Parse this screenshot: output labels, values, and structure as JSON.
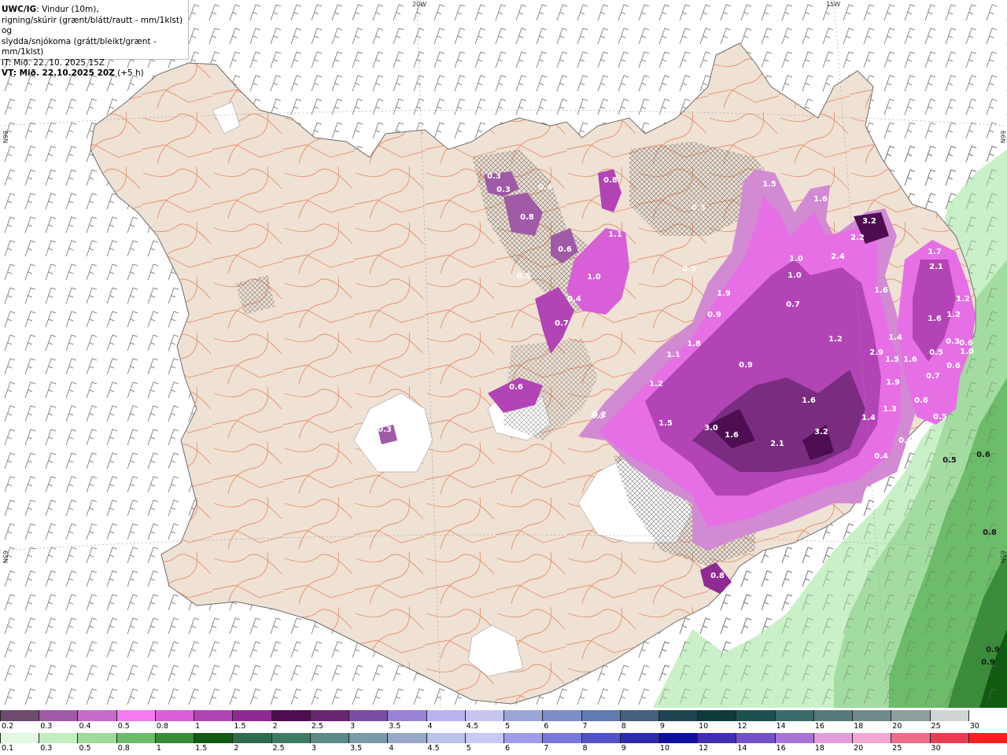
{
  "header": {
    "line1_bold": "UWC/IG",
    "line1_rest": ": Vindur (10m),",
    "line2": "rigning/skúrir (grænt/blátt/rautt - mm/1klst) og",
    "line3": "slydda/snjókoma (grátt/bleikt/grænt - mm/1klst)",
    "line4": "IT: Mið. 22. 10. 2025 15Z",
    "line5_bold": "VT: Mið. 22.10.2025 20Z",
    "line5_rest": " (+5 h)"
  },
  "grid_labels": {
    "lon_20w": "20W",
    "lon_15w": "15W",
    "lat_66n_left": "66N",
    "lat_66n_right": "66N",
    "lat_65n_left": "65N",
    "lat_65n_right": "65N"
  },
  "sleet_snow_labels": [
    {
      "v": "0.3"
    },
    {
      "v": "0.3"
    },
    {
      "v": "0.4"
    },
    {
      "v": "0.8"
    },
    {
      "v": "0.8"
    },
    {
      "v": "0.6"
    },
    {
      "v": "1.1"
    },
    {
      "v": "1.0"
    },
    {
      "v": "0.5"
    },
    {
      "v": "0.4"
    },
    {
      "v": "0.3"
    },
    {
      "v": "0.7"
    },
    {
      "v": "0.6"
    },
    {
      "v": "0.3"
    },
    {
      "v": "0.3"
    },
    {
      "v": "0.5"
    },
    {
      "v": "1.5"
    },
    {
      "v": "1.6"
    },
    {
      "v": "3.2"
    },
    {
      "v": "2.2"
    },
    {
      "v": "2.4"
    },
    {
      "v": "1.0"
    },
    {
      "v": "1.0"
    },
    {
      "v": "0.7"
    },
    {
      "v": "1.6"
    },
    {
      "v": "1.9"
    },
    {
      "v": "0.9"
    },
    {
      "v": "1.8"
    },
    {
      "v": "1.1"
    },
    {
      "v": "1.2"
    },
    {
      "v": "0.9"
    },
    {
      "v": "1.2"
    },
    {
      "v": "2.9"
    },
    {
      "v": "1.5"
    },
    {
      "v": "1.6"
    },
    {
      "v": "1.9"
    },
    {
      "v": "0.2"
    },
    {
      "v": "1.5"
    },
    {
      "v": "3.0"
    },
    {
      "v": "1.6"
    },
    {
      "v": "2.1"
    },
    {
      "v": "3.2"
    },
    {
      "v": "1.6"
    },
    {
      "v": "1.4"
    },
    {
      "v": "1.3"
    },
    {
      "v": "0.4"
    },
    {
      "v": "0.6"
    },
    {
      "v": "1.7"
    },
    {
      "v": "2.1"
    },
    {
      "v": "1.2"
    },
    {
      "v": "1.6"
    },
    {
      "v": "1.2"
    },
    {
      "v": "1.4"
    },
    {
      "v": "0.5"
    },
    {
      "v": "0.7"
    },
    {
      "v": "0.6"
    },
    {
      "v": "0.5"
    },
    {
      "v": "0.3"
    },
    {
      "v": "1.0"
    },
    {
      "v": "0.6"
    },
    {
      "v": "0.6"
    },
    {
      "v": "0.8"
    }
  ],
  "rain_labels": [
    {
      "v": "0.5"
    },
    {
      "v": "0.6"
    },
    {
      "v": "0.8"
    },
    {
      "v": "0.9"
    },
    {
      "v": "0.9"
    }
  ],
  "legend_snow": {
    "colors": [
      "#6d4a6e",
      "#a05aa6",
      "#c76ac9",
      "#f37af0",
      "#d85fd8",
      "#b244b6",
      "#8e2a92",
      "#4d0d50",
      "#6a2672",
      "#7a4ea2",
      "#9a82d8",
      "#b8b4f0",
      "#c6c6f0",
      "#9aa6d8",
      "#7c8ec8",
      "#617ab2",
      "#44607e",
      "#1e4450",
      "#0f3a3a",
      "#1e5050",
      "#3a6a6a",
      "#557a7a",
      "#6e8a8a",
      "#8c9e9e",
      "#cfd4d4",
      "#ffffff"
    ],
    "labels": [
      "0.2",
      "0.3",
      "0.4",
      "0.5",
      "0.8",
      "1",
      "1.5",
      "2",
      "2.5",
      "3",
      "3.5",
      "4",
      "4.5",
      "5",
      "6",
      "7",
      "8",
      "9",
      "10",
      "12",
      "14",
      "16",
      "18",
      "20",
      "25",
      "30"
    ]
  },
  "legend_rain": {
    "colors": [
      "#e2f8e2",
      "#c3efc0",
      "#9cdc98",
      "#6cbc6a",
      "#3a8c3a",
      "#115a11",
      "#2e6c4c",
      "#3e7c62",
      "#5a8a86",
      "#7a9aa8",
      "#98a8c8",
      "#b8c2ea",
      "#c6c8f6",
      "#9c9ce8",
      "#7878dc",
      "#5252c8",
      "#2c2cac",
      "#0f0fa0",
      "#4030b0",
      "#7450c8",
      "#a874d6",
      "#e29cdc",
      "#f2a8d2",
      "#ee6c8a",
      "#e83c50",
      "#ff2020"
    ],
    "labels": [
      "0.1",
      "0.3",
      "0.5",
      "0.8",
      "1",
      "1.5",
      "2",
      "2.5",
      "3",
      "3.5",
      "4",
      "4.5",
      "5",
      "6",
      "7",
      "8",
      "9",
      "10",
      "12",
      "14",
      "16",
      "18",
      "20",
      "25",
      "30"
    ]
  }
}
